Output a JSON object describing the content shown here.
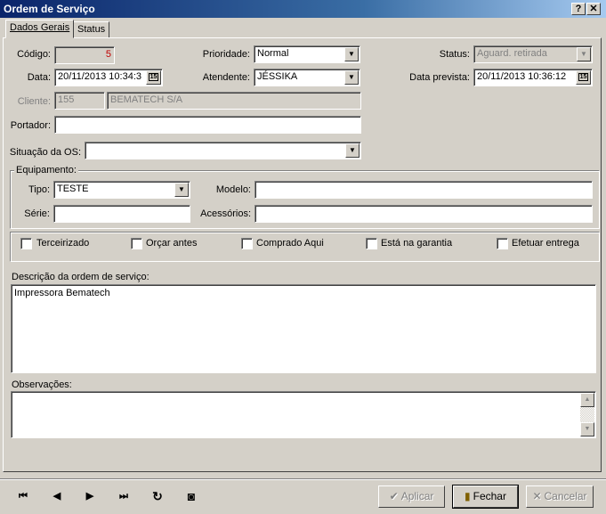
{
  "window": {
    "title": "Ordem de Serviço",
    "help_label": "?",
    "close_label": "✕"
  },
  "tabs": [
    {
      "label": "Dados Gerais"
    },
    {
      "label": "Status"
    }
  ],
  "form": {
    "codigo": {
      "label": "Código:",
      "value": "5"
    },
    "prioridade": {
      "label": "Prioridade:",
      "value": "Normal"
    },
    "status": {
      "label": "Status:",
      "value": "Aguard. retirada"
    },
    "data": {
      "label": "Data:",
      "value": "20/11/2013 10:34:3"
    },
    "atendente": {
      "label": "Atendente:",
      "value": "JÉSSIKA"
    },
    "data_prevista": {
      "label": "Data prevista:",
      "value": "20/11/2013 10:36:12"
    },
    "cliente": {
      "label": "Cliente:",
      "code": "155",
      "name": "BEMATECH S/A"
    },
    "portador": {
      "label": "Portador:",
      "value": ""
    },
    "situacao": {
      "label": "Situação da OS:",
      "value": ""
    }
  },
  "equipamento": {
    "legend": "Equipamento:",
    "tipo": {
      "label": "Tipo:",
      "value": "TESTE"
    },
    "modelo": {
      "label": "Modelo:",
      "value": ""
    },
    "serie": {
      "label": "Série:",
      "value": ""
    },
    "acessorios": {
      "label": "Acessórios:",
      "value": ""
    }
  },
  "checkboxes": [
    {
      "label": "Terceirizado"
    },
    {
      "label": "Orçar antes"
    },
    {
      "label": "Comprado Aqui"
    },
    {
      "label": "Está na garantia"
    },
    {
      "label": "Efetuar entrega"
    }
  ],
  "descricao": {
    "label": "Descrição da ordem de serviço:",
    "value": "Impressora Bematech"
  },
  "observacoes": {
    "label": "Observações:",
    "value": ""
  },
  "nav": {
    "first": "⏮",
    "prev": "◀",
    "next": "▶",
    "last": "⏭",
    "refresh": "↻",
    "record": "◙"
  },
  "buttons": {
    "aplicar": "Aplicar",
    "fechar": "Fechar",
    "cancelar": "Cancelar"
  },
  "icons": {
    "dropdown": "▼",
    "calendar": "15",
    "scroll_up": "▲",
    "scroll_down": "▼"
  }
}
